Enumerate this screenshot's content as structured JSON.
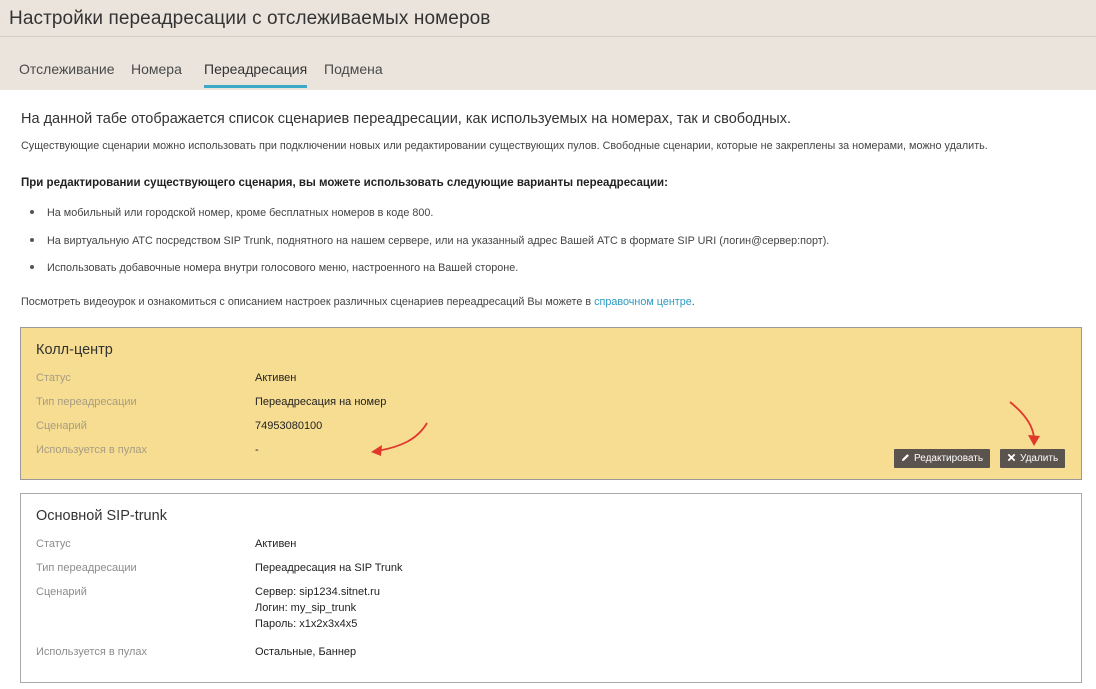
{
  "header": {
    "title": "Настройки переадресации с отслеживаемых номеров",
    "tabs": [
      {
        "label": "Отслеживание"
      },
      {
        "label": "Номера"
      },
      {
        "label": "Переадресация"
      },
      {
        "label": "Подмена"
      }
    ],
    "active_tab": "Переадресация"
  },
  "intro": {
    "main": "На данной табе отображается список сценариев переадресации, как используемых на номерах, так и свободных.",
    "sub": "Существующие сценарии можно использовать при подключении новых или редактировании существующих пулов. Свободные сценарии, которые не закреплены за номерами, можно удалить.",
    "bold": "При редактировании существующего сценария, вы можете использовать следующие варианты переадресации:",
    "bullets": [
      "На мобильный или городской номер, кроме бесплатных номеров в коде 800.",
      "На виртуальную АТС посредством SIP Trunk, поднятного на нашем сервере, или на указанный адрес Вашей АТС в формате SIP URI (логин@сервер:порт).",
      "Использовать добавочные номера внутри голосового меню, настроенного на Вашей стороне."
    ],
    "help_prefix": "Посмотреть видеоурок и ознакомиться с описанием настроек различных сценариев переадресаций Вы можете в ",
    "help_link": "справочном центре",
    "help_suffix": "."
  },
  "labels": {
    "status": "Статус",
    "type": "Тип переадресации",
    "scenario": "Сценарий",
    "pools": "Используется в пулах"
  },
  "cards": [
    {
      "title": "Колл-центр",
      "status": "Активен",
      "type": "Переадресация на номер",
      "scenario": "74953080100",
      "pools": "-",
      "edit_label": "Редактировать",
      "delete_label": "Удалить"
    },
    {
      "title": "Основной SIP-trunk",
      "status": "Активен",
      "type": "Переадресация на SIP Trunk",
      "scenario_lines": [
        "Сервер: sip1234.sitnet.ru",
        "Логин: my_sip_trunk",
        "Пароль: x1x2x3x4x5"
      ],
      "pools": "Остальные, Баннер"
    }
  ],
  "colors": {
    "header_bg": "#ebe4dc",
    "tab_accent": "#3aaac6",
    "highlight_card": "#f6dd92",
    "button": "#5b534e",
    "link": "#2c9ac2",
    "annotation_arrow": "#e0392b"
  },
  "icons": {
    "edit": "pencil-icon",
    "delete": "close-icon"
  }
}
